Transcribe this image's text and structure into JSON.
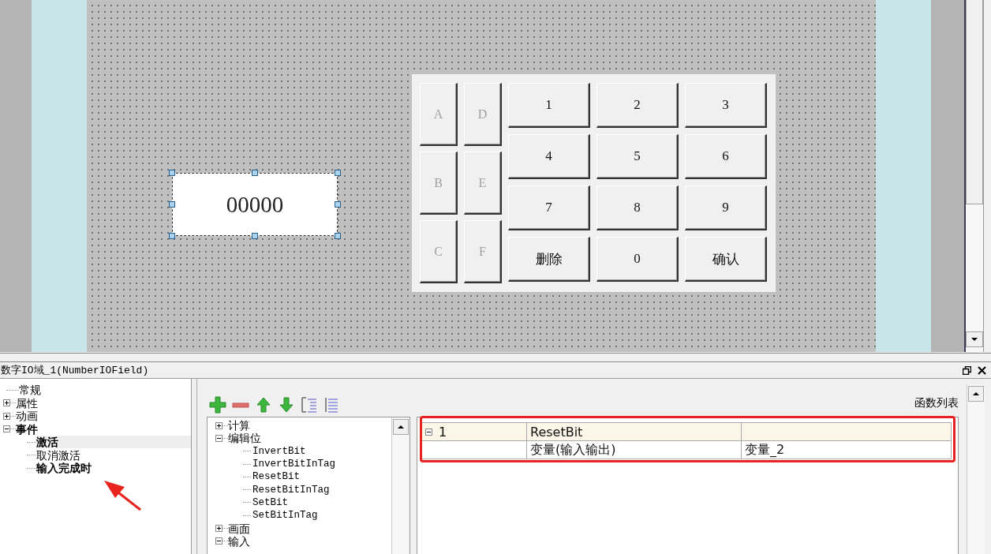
{
  "canvas": {
    "io_field": {
      "value": "00000",
      "selected": true
    },
    "keypad": {
      "letter_keys": [
        {
          "label": "A",
          "disabled": true
        },
        {
          "label": "D",
          "disabled": true
        },
        {
          "label": "B",
          "disabled": true
        },
        {
          "label": "E",
          "disabled": true
        },
        {
          "label": "C",
          "disabled": true
        },
        {
          "label": "F",
          "disabled": true
        }
      ],
      "number_keys": [
        "1",
        "2",
        "3",
        "4",
        "5",
        "6",
        "7",
        "8",
        "9",
        "删除",
        "0",
        "确认"
      ]
    }
  },
  "properties_panel": {
    "title": "数字IO域_1(NumberIOField)",
    "tree": [
      {
        "label": "常规",
        "selected": false,
        "bold": false
      },
      {
        "label": "属性",
        "selected": false,
        "bold": false,
        "expanded": false
      },
      {
        "label": "动画",
        "selected": false,
        "bold": false,
        "expanded": false
      },
      {
        "label": "事件",
        "selected": false,
        "bold": true,
        "expanded": true,
        "children": [
          {
            "label": "激活",
            "selected": true,
            "bold": true
          },
          {
            "label": "取消激活",
            "selected": false,
            "bold": false
          },
          {
            "label": "输入完成时",
            "selected": false,
            "bold": true
          }
        ]
      }
    ]
  },
  "function_editor": {
    "list_label": "函数列表",
    "function_tree": [
      {
        "label": "计算",
        "expanded": false
      },
      {
        "label": "编辑位",
        "expanded": true,
        "children": [
          {
            "label": "InvertBit"
          },
          {
            "label": "InvertBitInTag"
          },
          {
            "label": "ResetBit"
          },
          {
            "label": "ResetBitInTag"
          },
          {
            "label": "SetBit"
          },
          {
            "label": "SetBitInTag"
          }
        ]
      },
      {
        "label": "画面",
        "expanded": false
      },
      {
        "label": "输入",
        "expanded": true
      }
    ],
    "table": {
      "rows": [
        {
          "kind": "function",
          "index": "1",
          "name": "ResetBit",
          "expanded": true
        },
        {
          "kind": "parameter",
          "name": "变量(输入输出)",
          "value": "变量_2"
        }
      ]
    }
  }
}
